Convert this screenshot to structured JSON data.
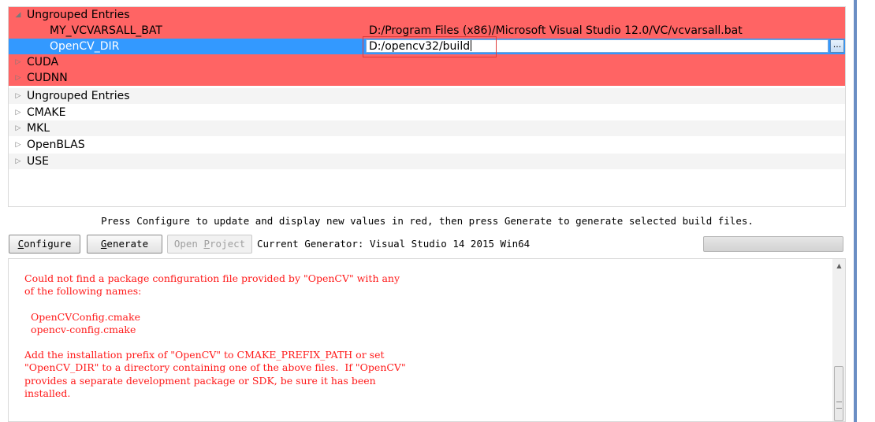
{
  "tree": {
    "group_expanded": {
      "label": "Ungrouped Entries",
      "toggle": "◢"
    },
    "entries": [
      {
        "name": "MY_VCVARSALL_BAT",
        "value": "D:/Program Files (x86)/Microsoft Visual Studio 12.0/VC/vcvarsall.bat"
      },
      {
        "name": "OpenCV_DIR",
        "value": "D:/opencv32/build",
        "browse_label": "..."
      }
    ],
    "groups": [
      {
        "label": "CUDA",
        "toggle": "▷"
      },
      {
        "label": "CUDNN",
        "toggle": "▷"
      },
      {
        "label": "Ungrouped Entries",
        "toggle": "▷"
      },
      {
        "label": "CMAKE",
        "toggle": "▷"
      },
      {
        "label": "MKL",
        "toggle": "▷"
      },
      {
        "label": "OpenBLAS",
        "toggle": "▷"
      },
      {
        "label": "USE",
        "toggle": "▷"
      }
    ]
  },
  "hint": "Press Configure to update and display new values in red, then press Generate to generate selected build files.",
  "toolbar": {
    "configure": {
      "first": "C",
      "rest": "onfigure"
    },
    "generate": {
      "first": "G",
      "rest": "enerate"
    },
    "open_project": {
      "pre": "Open ",
      "underlined": "P",
      "post": "roject"
    },
    "generator_text": "Current Generator: Visual Studio 14 2015 Win64"
  },
  "output": {
    "text": "Could not find a package configuration file provided by \"OpenCV\" with any\nof the following names:\n\n  OpenCVConfig.cmake\n  opencv-config.cmake\n\nAdd the installation prefix of \"OpenCV\" to CMAKE_PREFIX_PATH or set\n\"OpenCV_DIR\" to a directory containing one of the above files.  If \"OpenCV\"\nprovides a separate development package or SDK, be sure it has been\ninstalled."
  },
  "colors": {
    "changed_row": "#ff6464",
    "selected_row": "#3399ff",
    "error_text": "#ff1a1a"
  }
}
